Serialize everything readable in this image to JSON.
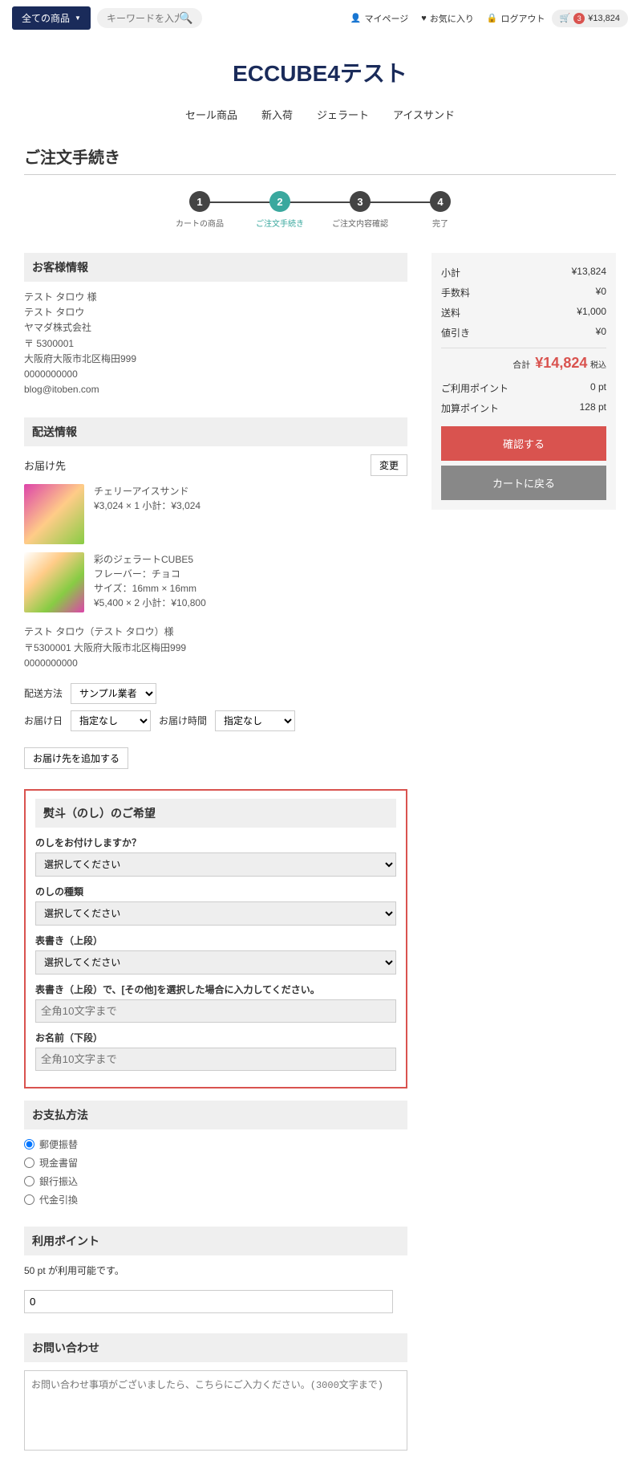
{
  "header": {
    "category": "全ての商品",
    "search_placeholder": "キーワードを入力",
    "mypage": "マイページ",
    "favorite": "お気に入り",
    "logout": "ログアウト",
    "cart_count": "3",
    "cart_amount": "¥13,824"
  },
  "logo": "ECCUBE4テスト",
  "nav": [
    "セール商品",
    "新入荷",
    "ジェラート",
    "アイスサンド"
  ],
  "page_title": "ご注文手続き",
  "steps": [
    {
      "n": "1",
      "label": "カートの商品"
    },
    {
      "n": "2",
      "label": "ご注文手続き"
    },
    {
      "n": "3",
      "label": "ご注文内容確認"
    },
    {
      "n": "4",
      "label": "完了"
    }
  ],
  "customer": {
    "heading": "お客様情報",
    "lines": [
      "テスト タロウ 様",
      "テスト タロウ",
      "ヤマダ株式会社",
      "〒 5300001",
      "大阪府大阪市北区梅田999",
      "0000000000",
      "blog@itoben.com"
    ]
  },
  "shipping": {
    "heading": "配送情報",
    "dest_label": "お届け先",
    "change_btn": "変更",
    "products": [
      {
        "name": "チェリーアイスサンド",
        "detail": "¥3,024 × 1  小計：¥3,024"
      },
      {
        "name": "彩のジェラートCUBE5",
        "flavor": "フレーバー：チョコ",
        "size": "サイズ：16mm × 16mm",
        "detail": "¥5,400 × 2  小計：¥10,800"
      }
    ],
    "address": [
      "テスト タロウ（テスト タロウ）様",
      "〒5300001 大阪府大阪市北区梅田999",
      "0000000000"
    ],
    "method_label": "配送方法",
    "method_value": "サンプル業者",
    "date_label": "お届け日",
    "date_value": "指定なし",
    "time_label": "お届け時間",
    "time_value": "指定なし",
    "add_dest_btn": "お届け先を追加する"
  },
  "noshi": {
    "heading": "熨斗（のし）のご希望",
    "q1": "のしをお付けしますか？",
    "q2": "のしの種類",
    "q3": "表書き（上段）",
    "q4": "表書き（上段）で、[その他]を選択した場合に入力してください。",
    "q4_placeholder": "全角10文字まで",
    "q5": "お名前（下段）",
    "q5_placeholder": "全角10文字まで",
    "select_default": "選択してください"
  },
  "payment": {
    "heading": "お支払方法",
    "options": [
      "郵便振替",
      "現金書留",
      "銀行振込",
      "代金引換"
    ]
  },
  "points": {
    "heading": "利用ポイント",
    "info": "50 pt が利用可能です。",
    "value": "0"
  },
  "contact": {
    "heading": "お問い合わせ",
    "placeholder": "お問い合わせ事項がございましたら、こちらにご入力ください。(3000文字まで)"
  },
  "summary": {
    "rows": [
      {
        "label": "小計",
        "value": "¥13,824"
      },
      {
        "label": "手数料",
        "value": "¥0"
      },
      {
        "label": "送料",
        "value": "¥1,000"
      },
      {
        "label": "値引き",
        "value": "¥0"
      }
    ],
    "total_label": "合計",
    "total_value": "¥14,824",
    "tax_label": "税込",
    "point_rows": [
      {
        "label": "ご利用ポイント",
        "value": "0 pt"
      },
      {
        "label": "加算ポイント",
        "value": "128 pt"
      }
    ],
    "confirm_btn": "確認する",
    "cart_btn": "カートに戻る"
  }
}
